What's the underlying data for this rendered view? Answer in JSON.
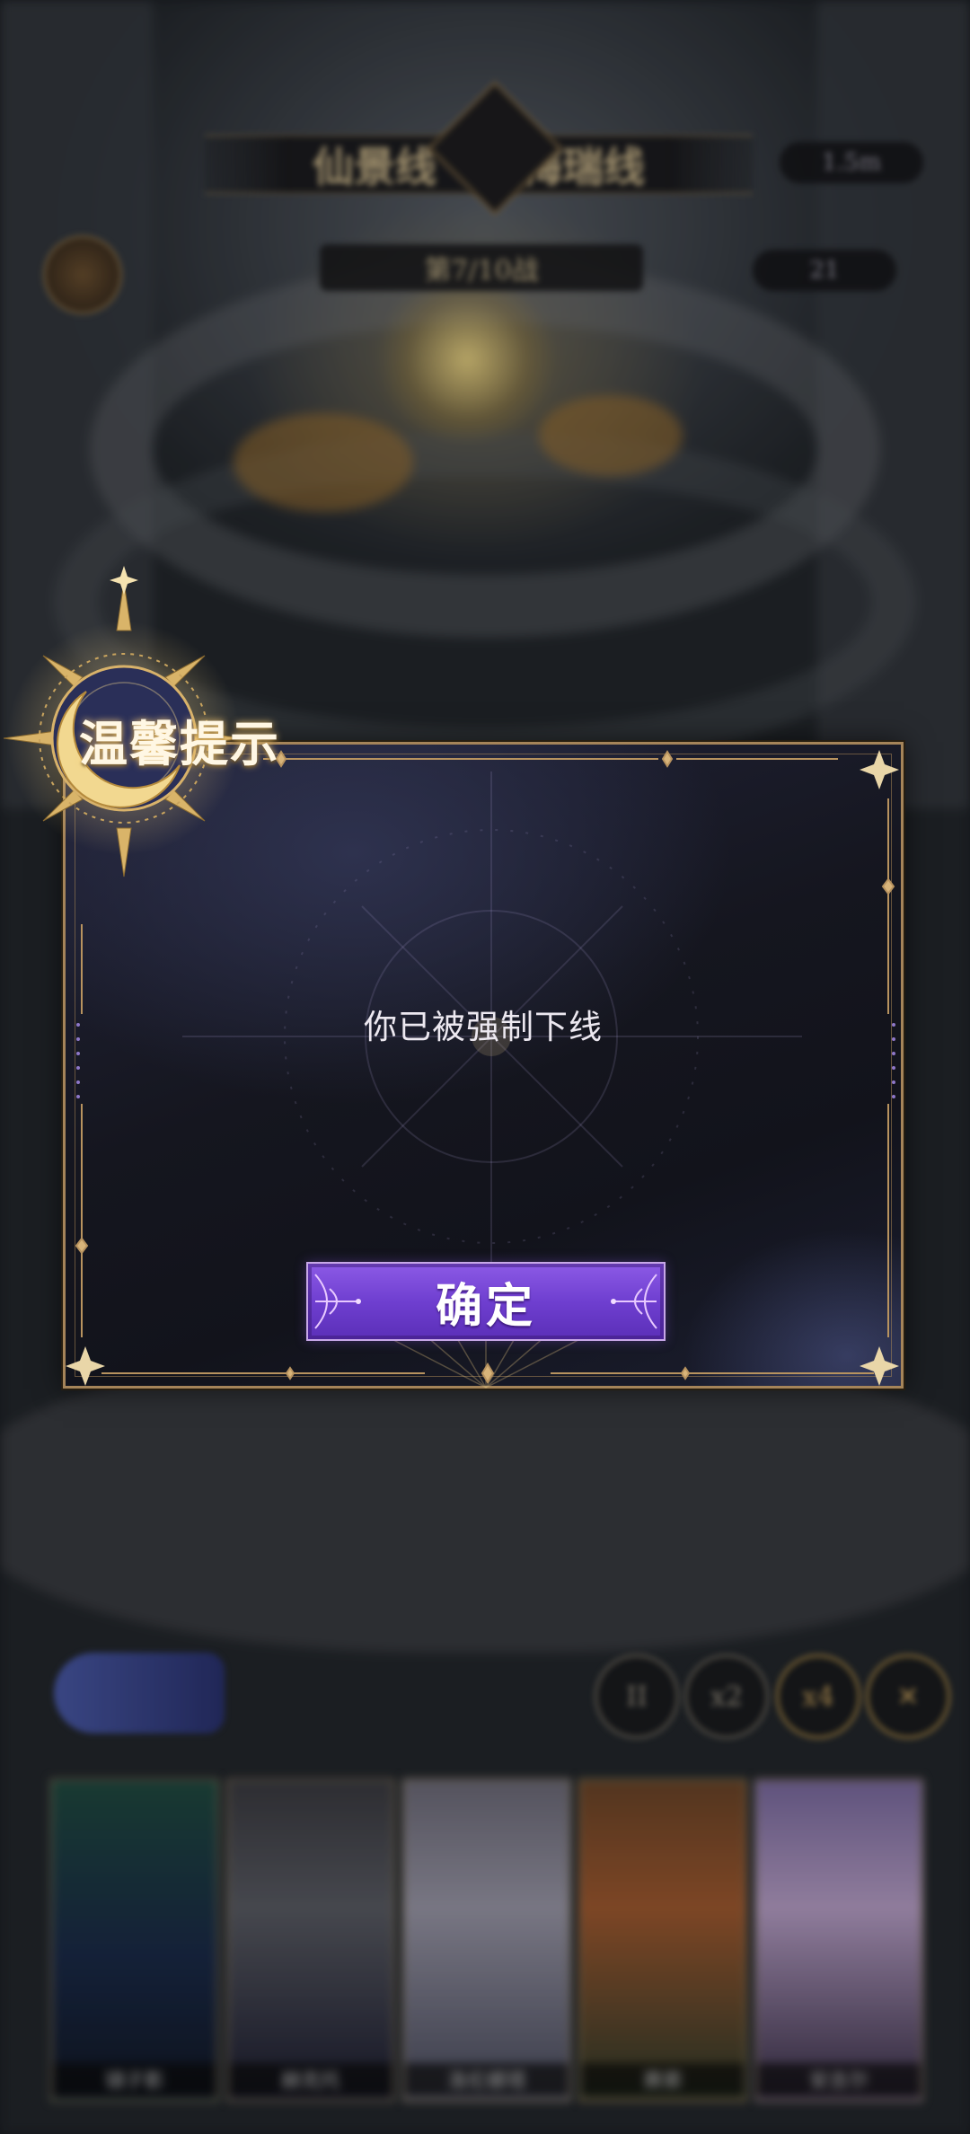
{
  "background": {
    "hud": {
      "title_left": "仙景线",
      "title_right": "梅瑞线",
      "stage": "第7/10战",
      "right_pill_1": "1.5m",
      "right_pill_2": "21"
    },
    "controls": {
      "pause_label": "II",
      "speed_2_label": "x2",
      "speed_4_label": "x4",
      "close_label": "✕"
    },
    "heroes": [
      {
        "name": "镜子影"
      },
      {
        "name": "赫克托"
      },
      {
        "name": "洛伦娜塔"
      },
      {
        "name": "赛索"
      },
      {
        "name": "安吉尔"
      }
    ]
  },
  "dialog": {
    "title": "温馨提示",
    "message": "你已被强制下线",
    "confirm_label": "确定"
  },
  "colors": {
    "frame_gold": "#a58459",
    "panel_dark": "#15161f",
    "button_purple": "#6f3fd0",
    "text_light": "#ece8f0"
  }
}
